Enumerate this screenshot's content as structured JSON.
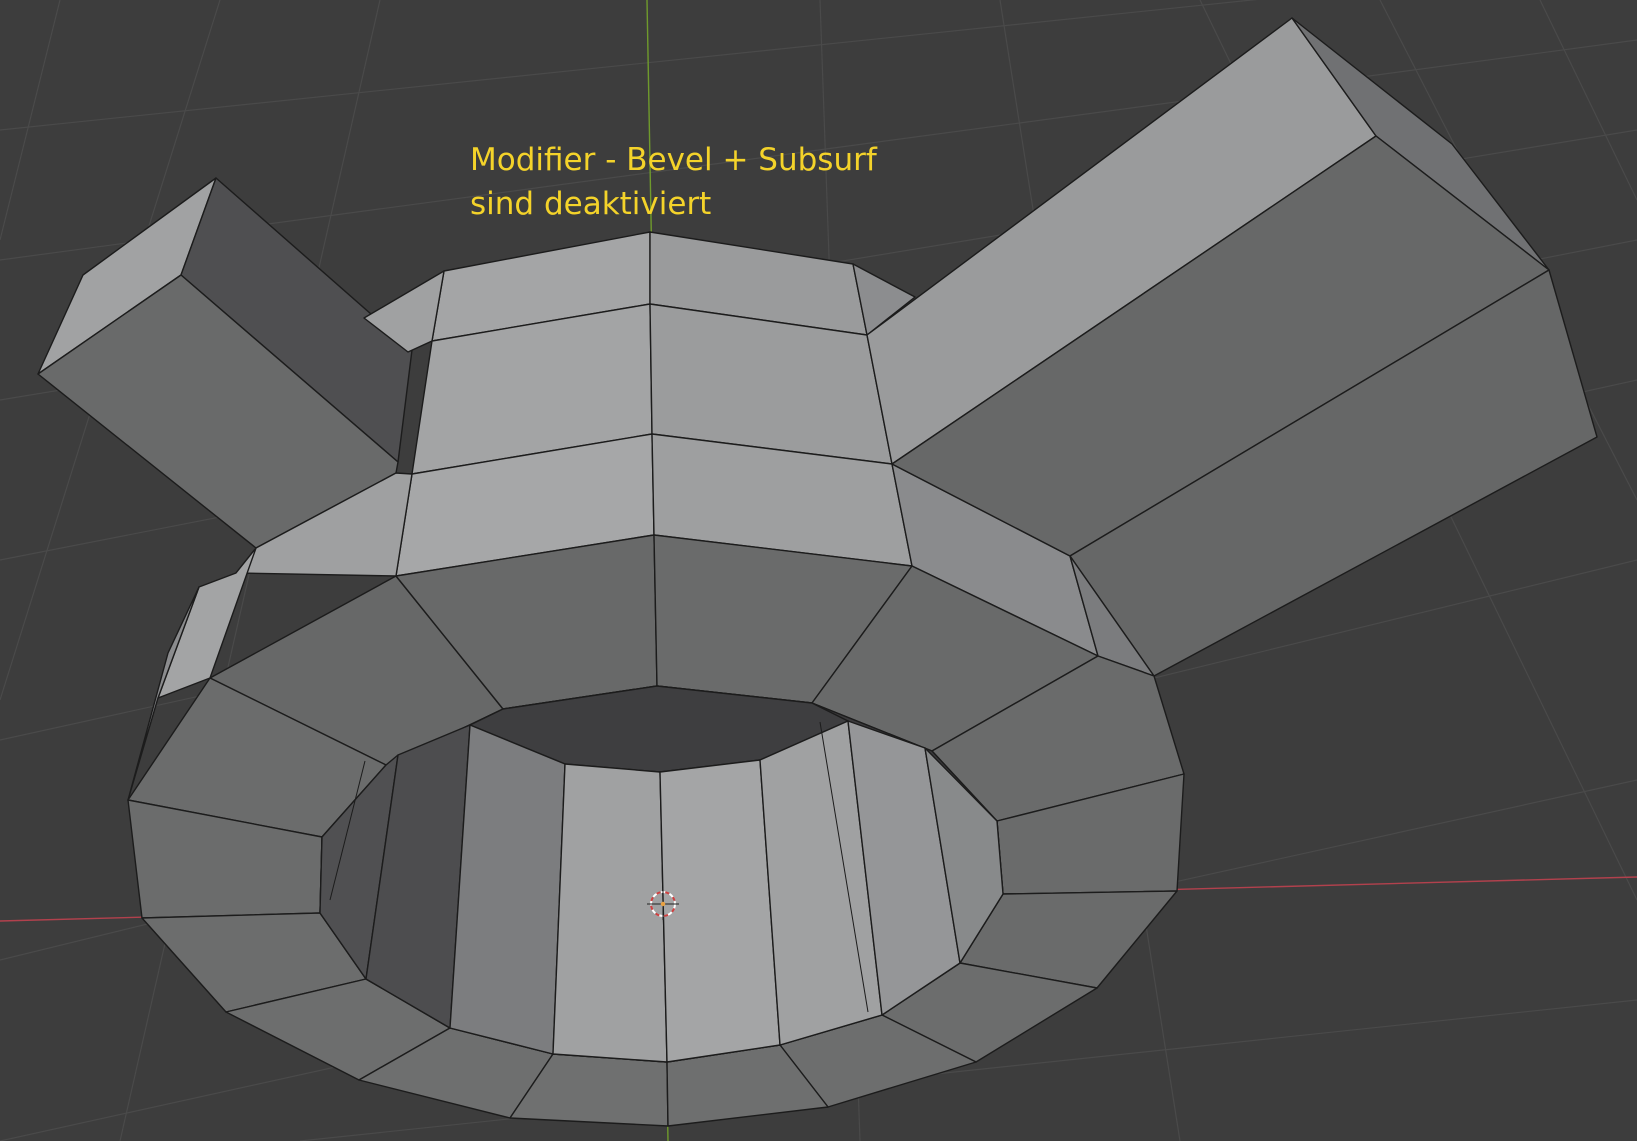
{
  "viewport": {
    "annotation": {
      "line1": "Modifier - Bevel + Subsurf",
      "line2": "sind deaktiviert"
    },
    "colors": {
      "background": "#3d3d3d",
      "grid": "#4a4a4a",
      "x_axis": "#b2414d",
      "y_axis": "#6f9a2c",
      "annotation_text": "#f4d32a",
      "face_light": "#9c9d9e",
      "face_mid": "#838486",
      "face_dark": "#676868",
      "face_darker": "#505052",
      "face_inner": "#3b3a3c",
      "edge": "#1c1c1c"
    },
    "icons": {
      "cursor": "3d-cursor-icon"
    }
  }
}
